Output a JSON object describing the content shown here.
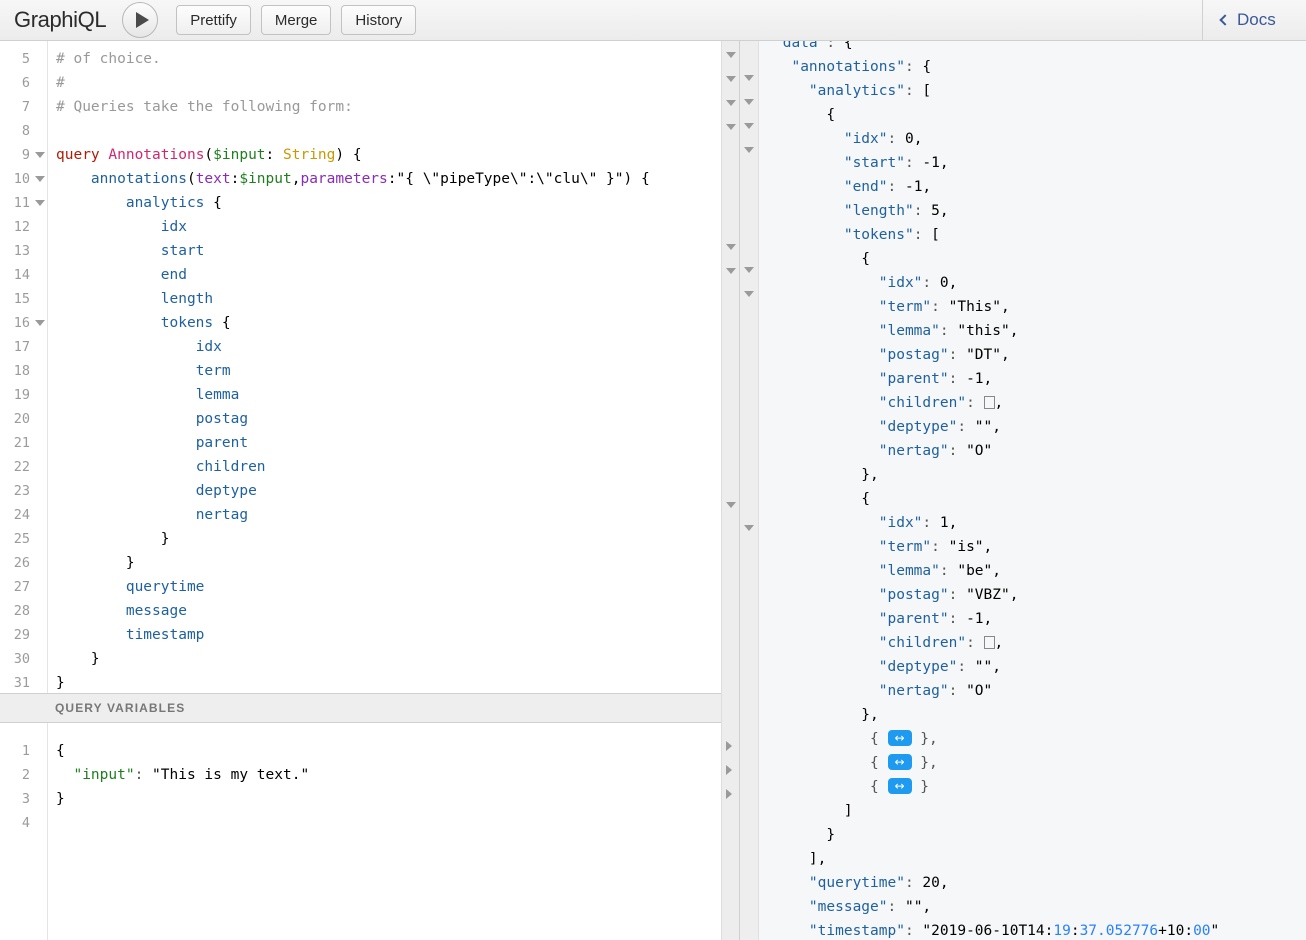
{
  "toolbar": {
    "logo": "GraphiQL",
    "execute_title": "Execute Query",
    "prettify_label": "Prettify",
    "merge_label": "Merge",
    "history_label": "History",
    "docs_label": "Docs",
    "accent_color": "#3b5998"
  },
  "query_editor": {
    "first_visible_line": 5,
    "lines": [
      {
        "n": 5,
        "fold": "none",
        "text": "# of choice."
      },
      {
        "n": 6,
        "fold": "none",
        "text": "#"
      },
      {
        "n": 7,
        "fold": "none",
        "text": "# Queries take the following form:"
      },
      {
        "n": 8,
        "fold": "none",
        "text": ""
      },
      {
        "n": 9,
        "fold": "down",
        "text": "query Annotations($input: String) {"
      },
      {
        "n": 10,
        "fold": "down",
        "text": "    annotations(text:$input,parameters:\"{ \\\"pipeType\\\":\\\"clu\\\" }\") {"
      },
      {
        "n": 11,
        "fold": "down",
        "text": "        analytics {"
      },
      {
        "n": 12,
        "fold": "none",
        "text": "            idx"
      },
      {
        "n": 13,
        "fold": "none",
        "text": "            start"
      },
      {
        "n": 14,
        "fold": "none",
        "text": "            end"
      },
      {
        "n": 15,
        "fold": "none",
        "text": "            length"
      },
      {
        "n": 16,
        "fold": "down",
        "text": "            tokens {"
      },
      {
        "n": 17,
        "fold": "none",
        "text": "                idx"
      },
      {
        "n": 18,
        "fold": "none",
        "text": "                term"
      },
      {
        "n": 19,
        "fold": "none",
        "text": "                lemma"
      },
      {
        "n": 20,
        "fold": "none",
        "text": "                postag"
      },
      {
        "n": 21,
        "fold": "none",
        "text": "                parent"
      },
      {
        "n": 22,
        "fold": "none",
        "text": "                children"
      },
      {
        "n": 23,
        "fold": "none",
        "text": "                deptype"
      },
      {
        "n": 24,
        "fold": "none",
        "text": "                nertag"
      },
      {
        "n": 25,
        "fold": "none",
        "text": "            }"
      },
      {
        "n": 26,
        "fold": "none",
        "text": "        }"
      },
      {
        "n": 27,
        "fold": "none",
        "text": "        querytime"
      },
      {
        "n": 28,
        "fold": "none",
        "text": "        message"
      },
      {
        "n": 29,
        "fold": "none",
        "text": "        timestamp"
      },
      {
        "n": 30,
        "fold": "none",
        "text": "    }"
      },
      {
        "n": 31,
        "fold": "none",
        "text": "}"
      }
    ]
  },
  "query_variables": {
    "header_label": "QUERY VARIABLES",
    "lines": [
      {
        "n": 1,
        "text": "{"
      },
      {
        "n": 2,
        "text": "  \"input\": \"This is my text.\""
      },
      {
        "n": 3,
        "text": "}"
      },
      {
        "n": 4,
        "text": ""
      }
    ],
    "variables_value": {
      "input": "This is my text."
    }
  },
  "result": {
    "lines": [
      "\"data\": {",
      "  \"annotations\": {",
      "    \"analytics\": [",
      "      {",
      "        \"idx\": 0,",
      "        \"start\": -1,",
      "        \"end\": -1,",
      "        \"length\": 5,",
      "        \"tokens\": [",
      "          {",
      "            \"idx\": 0,",
      "            \"term\": \"This\",",
      "            \"lemma\": \"this\",",
      "            \"postag\": \"DT\",",
      "            \"parent\": -1,",
      "            \"children\": [],",
      "            \"deptype\": \"\",",
      "            \"nertag\": \"O\"",
      "          },",
      "          {",
      "            \"idx\": 1,",
      "            \"term\": \"is\",",
      "            \"lemma\": \"be\",",
      "            \"postag\": \"VBZ\",",
      "            \"parent\": -1,",
      "            \"children\": [],",
      "            \"deptype\": \"\",",
      "            \"nertag\": \"O\"",
      "          },",
      "          { COLLAPSED },",
      "          { COLLAPSED },",
      "          { COLLAPSED }",
      "        ]",
      "      }",
      "    ],",
      "    \"querytime\": 20,",
      "    \"message\": \"\",",
      "    \"timestamp\": \"2019-06-10T14:19:37.052776+10:00\""
    ],
    "collapsed_badge_glyph": "↔",
    "values": {
      "querytime": 20,
      "message": "",
      "timestamp": "2019-06-10T14:19:37.052776+10:00",
      "analytics_0": {
        "idx": 0,
        "start": -1,
        "end": -1,
        "length": 5,
        "tokens": [
          {
            "idx": 0,
            "term": "This",
            "lemma": "this",
            "postag": "DT",
            "parent": -1,
            "children": [],
            "deptype": "",
            "nertag": "O"
          },
          {
            "idx": 1,
            "term": "is",
            "lemma": "be",
            "postag": "VBZ",
            "parent": -1,
            "children": [],
            "deptype": "",
            "nertag": "O"
          }
        ],
        "collapsed_token_count": 3
      }
    }
  },
  "colors": {
    "keyword": "#b11a04",
    "def": "#d2276f",
    "variable": "#1f7f1f",
    "type": "#ca9800",
    "attribute": "#1f61a0",
    "argument": "#8b2bb9",
    "string": "#d64292",
    "number": "#2882f9",
    "comment": "#999999",
    "badge": "#1e9bf0"
  }
}
